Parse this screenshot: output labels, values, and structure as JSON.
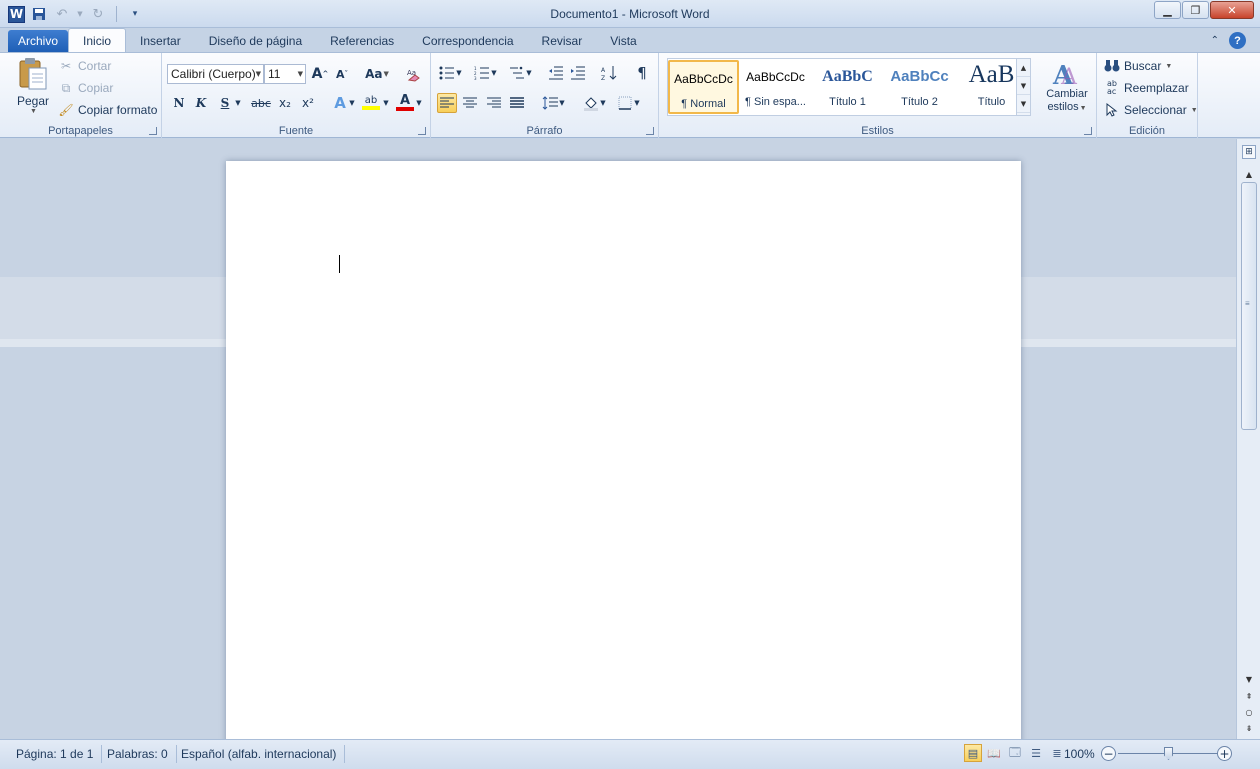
{
  "window": {
    "title": "Documento1  -  Microsoft Word",
    "app_icon": "W",
    "controls": [
      "minimize-icon",
      "restore-icon",
      "close-icon"
    ]
  },
  "qat": {
    "icons": [
      "save-icon",
      "undo-icon",
      "redo-icon",
      "customize-qat-icon"
    ]
  },
  "tabs": [
    {
      "label": "Archivo",
      "kind": "file"
    },
    {
      "label": "Inicio",
      "active": true
    },
    {
      "label": "Insertar"
    },
    {
      "label": "Diseño de página"
    },
    {
      "label": "Referencias"
    },
    {
      "label": "Correspondencia"
    },
    {
      "label": "Revisar"
    },
    {
      "label": "Vista"
    }
  ],
  "ribbon": {
    "clipboard": {
      "label": "Portapapeles",
      "paste": "Pegar",
      "cut": "Cortar",
      "copy": "Copiar",
      "format_painter": "Copiar formato"
    },
    "font": {
      "label": "Fuente",
      "font_name": "Calibri (Cuerpo)",
      "font_size": "11",
      "change_case": "Aa",
      "bold": "N",
      "italic": "K",
      "underline": "S",
      "strikethrough": "abc",
      "subscript": "x₂",
      "superscript": "x²",
      "grow": "A",
      "shrink": "A",
      "text_effects": "A",
      "highlight": "ab",
      "font_color": "A"
    },
    "paragraph": {
      "label": "Párrafo",
      "show_marks": "¶"
    },
    "styles": {
      "label": "Estilos",
      "items": [
        {
          "sample": "AaBbCcDc",
          "name": "¶ Normal",
          "active": true
        },
        {
          "sample": "AaBbCcDc",
          "name": "¶ Sin espa..."
        },
        {
          "sample": "AaBbC",
          "name": "Título 1"
        },
        {
          "sample": "AaBbCc",
          "name": "Título 2"
        },
        {
          "sample": "AaB",
          "name": "Título"
        }
      ],
      "change_styles_line1": "Cambiar",
      "change_styles_line2": "estilos"
    },
    "editing": {
      "label": "Edición",
      "find": "Buscar",
      "replace": "Reemplazar",
      "select": "Seleccionar"
    }
  },
  "status": {
    "page": "Página: 1 de 1",
    "words": "Palabras: 0",
    "language": "Español (alfab. internacional)",
    "zoom": "100%",
    "zoom_value": 100
  },
  "colors": {
    "file_tab": "#1f5fb6",
    "highlight_yellow": "#ffff00",
    "font_color_red": "#e00000",
    "active_button": "#f8cf5a"
  }
}
